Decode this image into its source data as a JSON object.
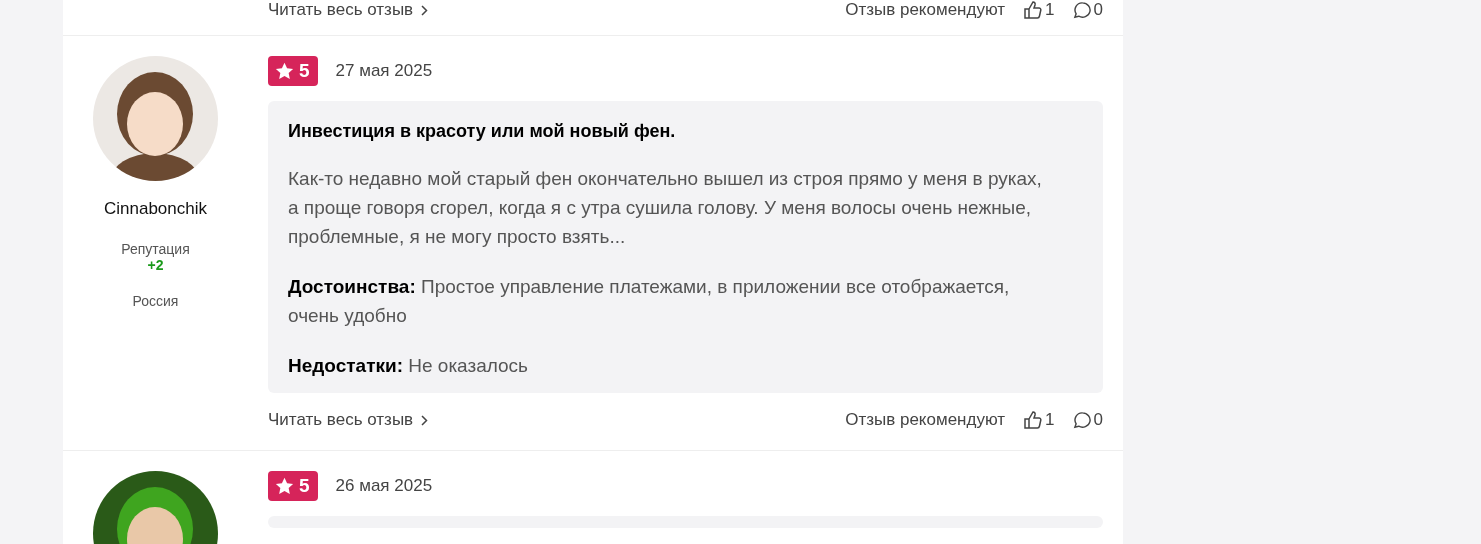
{
  "previous_review": {
    "read_more": "Читать весь отзыв",
    "recommend_label": "Отзыв рекомендуют",
    "likes": "1",
    "comments": "0"
  },
  "review": {
    "author": "Cinnabonchik",
    "reputation_label": "Репутация",
    "reputation": "+2",
    "country": "Россия",
    "rating": "5",
    "date": "27 мая 2025",
    "title": "Инвестиция в красоту или мой новый фен.",
    "text": "Как-то недавно мой старый фен окончательно вышел из строя прямо у меня в руках, а проще говоря сгорел, когда я с утра сушила голову. У меня волосы очень нежные, проблемные, я не могу просто взять...",
    "pros_label": "Достоинства:",
    "pros": "Простое управление платежами, в приложении все отображается, очень удобно",
    "cons_label": "Недостатки:",
    "cons": "Не оказалось",
    "read_more": "Читать весь отзыв",
    "recommend_label": "Отзыв рекомендуют",
    "likes": "1",
    "comments": "0"
  },
  "next_review": {
    "rating": "5",
    "date": "26 мая 2025"
  }
}
